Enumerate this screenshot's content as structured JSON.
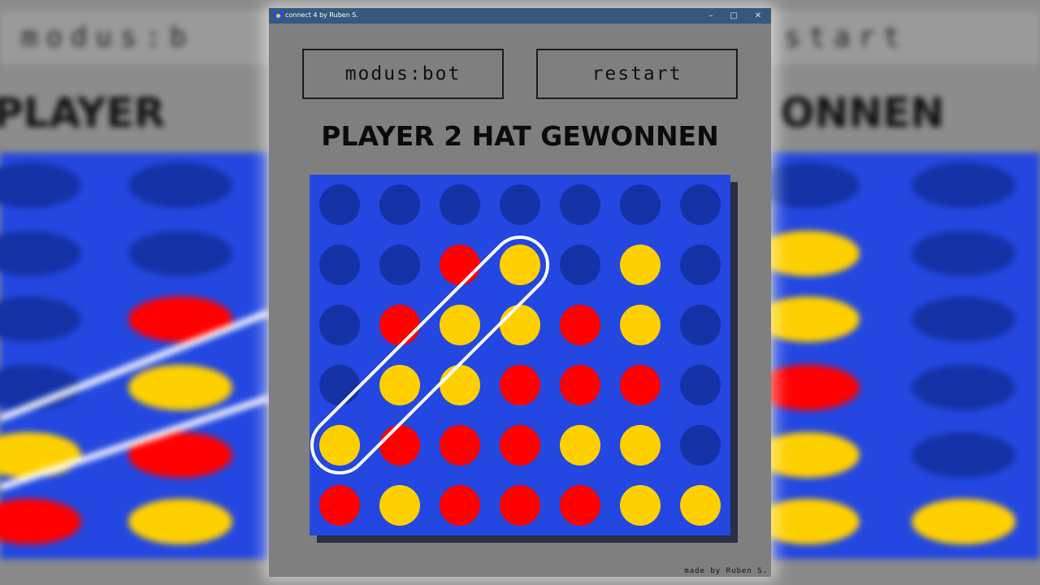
{
  "window": {
    "title": "connect 4 by Ruben S.",
    "minimize_icon": "–",
    "maximize_icon": "□",
    "close_icon": "✕"
  },
  "buttons": {
    "mode_label": "modus:bot",
    "restart_label": "restart"
  },
  "status": "PLAYER 2 HAT GEWONNEN",
  "credit": "made by Ruben S.",
  "colors": {
    "board": "#2347e0",
    "empty": "#1432a6",
    "red": "#ff0000",
    "yellow": "#ffd000",
    "highlight": "#ffffff"
  },
  "board": {
    "columns": 7,
    "rows": 6,
    "cells": [
      [
        "empty",
        "empty",
        "empty",
        "empty",
        "empty",
        "empty",
        "empty"
      ],
      [
        "empty",
        "empty",
        "red",
        "yellow",
        "empty",
        "yellow",
        "empty"
      ],
      [
        "empty",
        "red",
        "yellow",
        "yellow",
        "red",
        "yellow",
        "empty"
      ],
      [
        "empty",
        "yellow",
        "yellow",
        "red",
        "red",
        "red",
        "empty"
      ],
      [
        "yellow",
        "red",
        "red",
        "red",
        "yellow",
        "yellow",
        "empty"
      ],
      [
        "red",
        "yellow",
        "red",
        "red",
        "red",
        "yellow",
        "yellow"
      ]
    ],
    "winning_line": {
      "from": [
        4,
        0
      ],
      "to": [
        1,
        3
      ],
      "player": "yellow"
    }
  },
  "background": {
    "mode_text": "modus:b",
    "restart_text": "start",
    "left_heading": "PLAYER",
    "right_heading": "ONNEN"
  }
}
